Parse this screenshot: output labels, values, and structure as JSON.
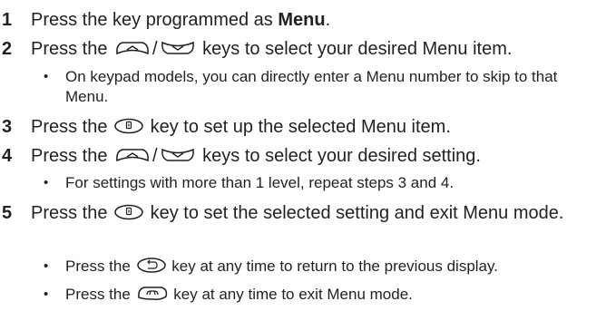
{
  "steps": [
    {
      "number": "1",
      "prefix": "Press the key programmed as ",
      "bold": "Menu",
      "suffix": "."
    },
    {
      "number": "2",
      "prefix": "Press the ",
      "separator": "/",
      "suffix": " keys to select your desired Menu item."
    },
    {
      "number": "3",
      "prefix": "Press the ",
      "suffix": " key to set up the selected Menu item."
    },
    {
      "number": "4",
      "prefix": "Press the ",
      "separator": "/",
      "suffix": " keys to select your desired setting."
    },
    {
      "number": "5",
      "prefix": "Press the ",
      "suffix": " key to set the selected setting and exit Menu mode."
    }
  ],
  "notes": {
    "step2": {
      "bullet": "•",
      "text": "On keypad models, you can directly enter a Menu number to skip to that Menu."
    },
    "step4": {
      "bullet": "•",
      "text": "For settings with more than 1 level, repeat steps 3 and 4."
    },
    "step5_a": {
      "bullet": "•",
      "prefix": "Press the ",
      "suffix": " key at any time to return to the previous display."
    },
    "step5_b": {
      "bullet": "•",
      "prefix": "Press the ",
      "suffix": " key at any time to exit Menu mode."
    }
  },
  "icons": {
    "up": "navigator-up-key-icon",
    "down": "navigator-down-key-icon",
    "enter": "enter-key-icon",
    "cancel": "cancel-back-key-icon",
    "end": "end-key-icon"
  }
}
